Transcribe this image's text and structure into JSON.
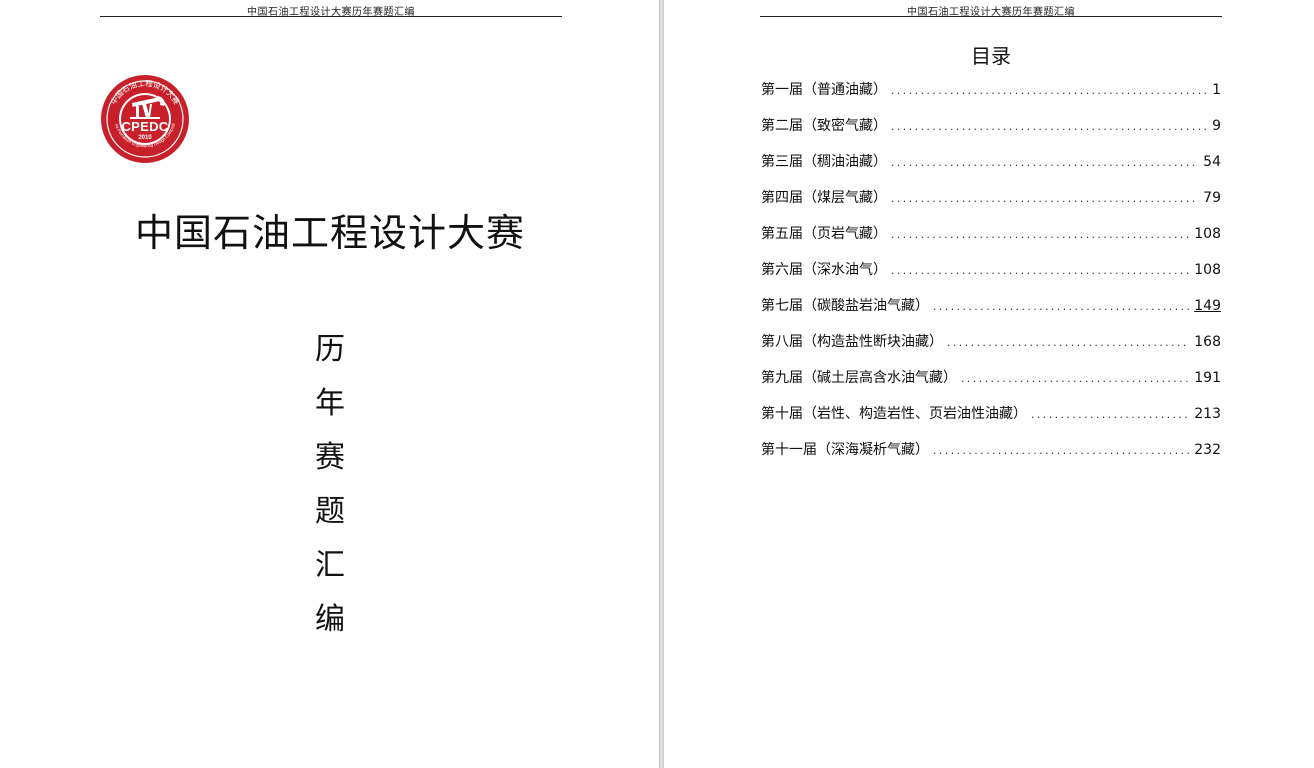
{
  "running_header": "中国石油工程设计大赛历年赛题汇编",
  "cover": {
    "logo": {
      "ring_text": "中国石油工程设计大赛",
      "ring_text_en": "China Petroleum Engineering Design Competition",
      "abbr": "CPEDC",
      "year": "2010",
      "color": "#c8202a"
    },
    "title": "中国石油工程设计大赛",
    "subtitle_chars": [
      "历",
      "年",
      "赛",
      "题",
      "汇",
      "编"
    ]
  },
  "toc": {
    "title": "目录",
    "dots": "..................................................................................",
    "entries": [
      {
        "label": "第一届（普通油藏）",
        "page": "1"
      },
      {
        "label": "第二届（致密气藏）",
        "page": "9"
      },
      {
        "label": "第三届（稠油油藏）",
        "page": "54"
      },
      {
        "label": "第四届（煤层气藏）",
        "page": "79"
      },
      {
        "label": "第五届（页岩气藏）",
        "page": "108"
      },
      {
        "label": "第六届（深水油气）",
        "page": "108"
      },
      {
        "label": "第七届（碳酸盐岩油气藏）",
        "page": "149"
      },
      {
        "label": "第八届（构造盐性断块油藏）",
        "page": "168"
      },
      {
        "label": "第九届（碱土层高含水油气藏）",
        "page": "191"
      },
      {
        "label": "第十届（岩性、构造岩性、页岩油性油藏）",
        "page": "213"
      },
      {
        "label": "第十一届（深海凝析气藏）",
        "page": "232"
      }
    ]
  }
}
